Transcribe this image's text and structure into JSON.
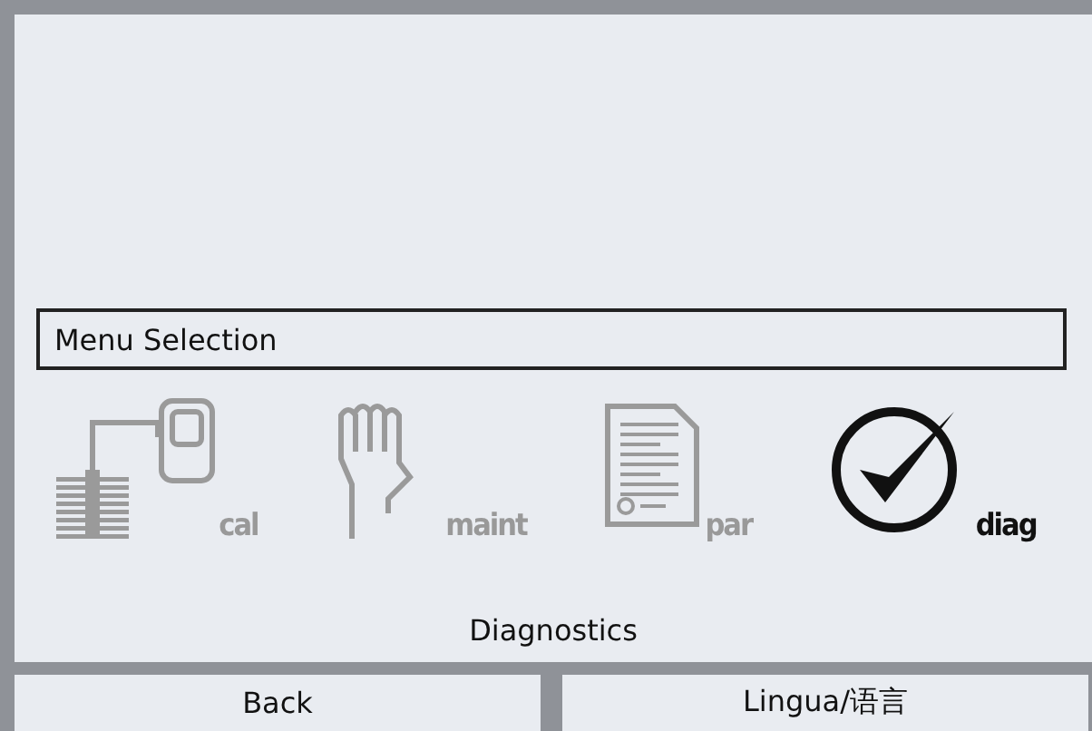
{
  "header": {
    "title": "Menu Selection"
  },
  "menu_items": [
    {
      "kind": "cal",
      "label": "cal",
      "selected": false
    },
    {
      "kind": "maint",
      "label": "maint",
      "selected": false
    },
    {
      "kind": "par",
      "label": "par",
      "selected": false
    },
    {
      "kind": "diag",
      "label": "diag",
      "selected": true
    }
  ],
  "selection_label": "Diagnostics",
  "softkeys": [
    "Back",
    "Lingua/语言"
  ]
}
